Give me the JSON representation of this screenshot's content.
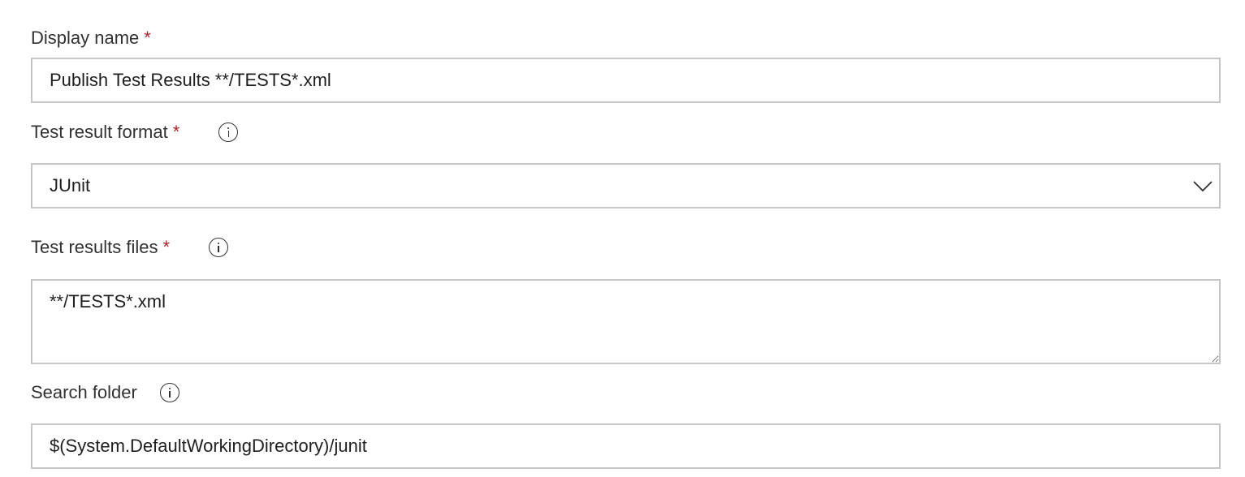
{
  "display_name": {
    "label": "Display name",
    "required_mark": "*",
    "value": "Publish Test Results **/TESTS*.xml"
  },
  "test_result_format": {
    "label": "Test result format",
    "required_mark": "*",
    "info_icon": "info-icon",
    "selected": "JUnit",
    "dropdown_icon": "chevron-down-icon"
  },
  "test_results_files": {
    "label": "Test results files",
    "required_mark": "*",
    "info_icon": "info-icon",
    "value": "**/TESTS*.xml"
  },
  "search_folder": {
    "label": "Search folder",
    "info_icon": "info-icon",
    "value": "$(System.DefaultWorkingDirectory)/junit"
  },
  "colors": {
    "required": "#a4262c",
    "border": "#c8c6c4",
    "text": "#201f1e"
  }
}
